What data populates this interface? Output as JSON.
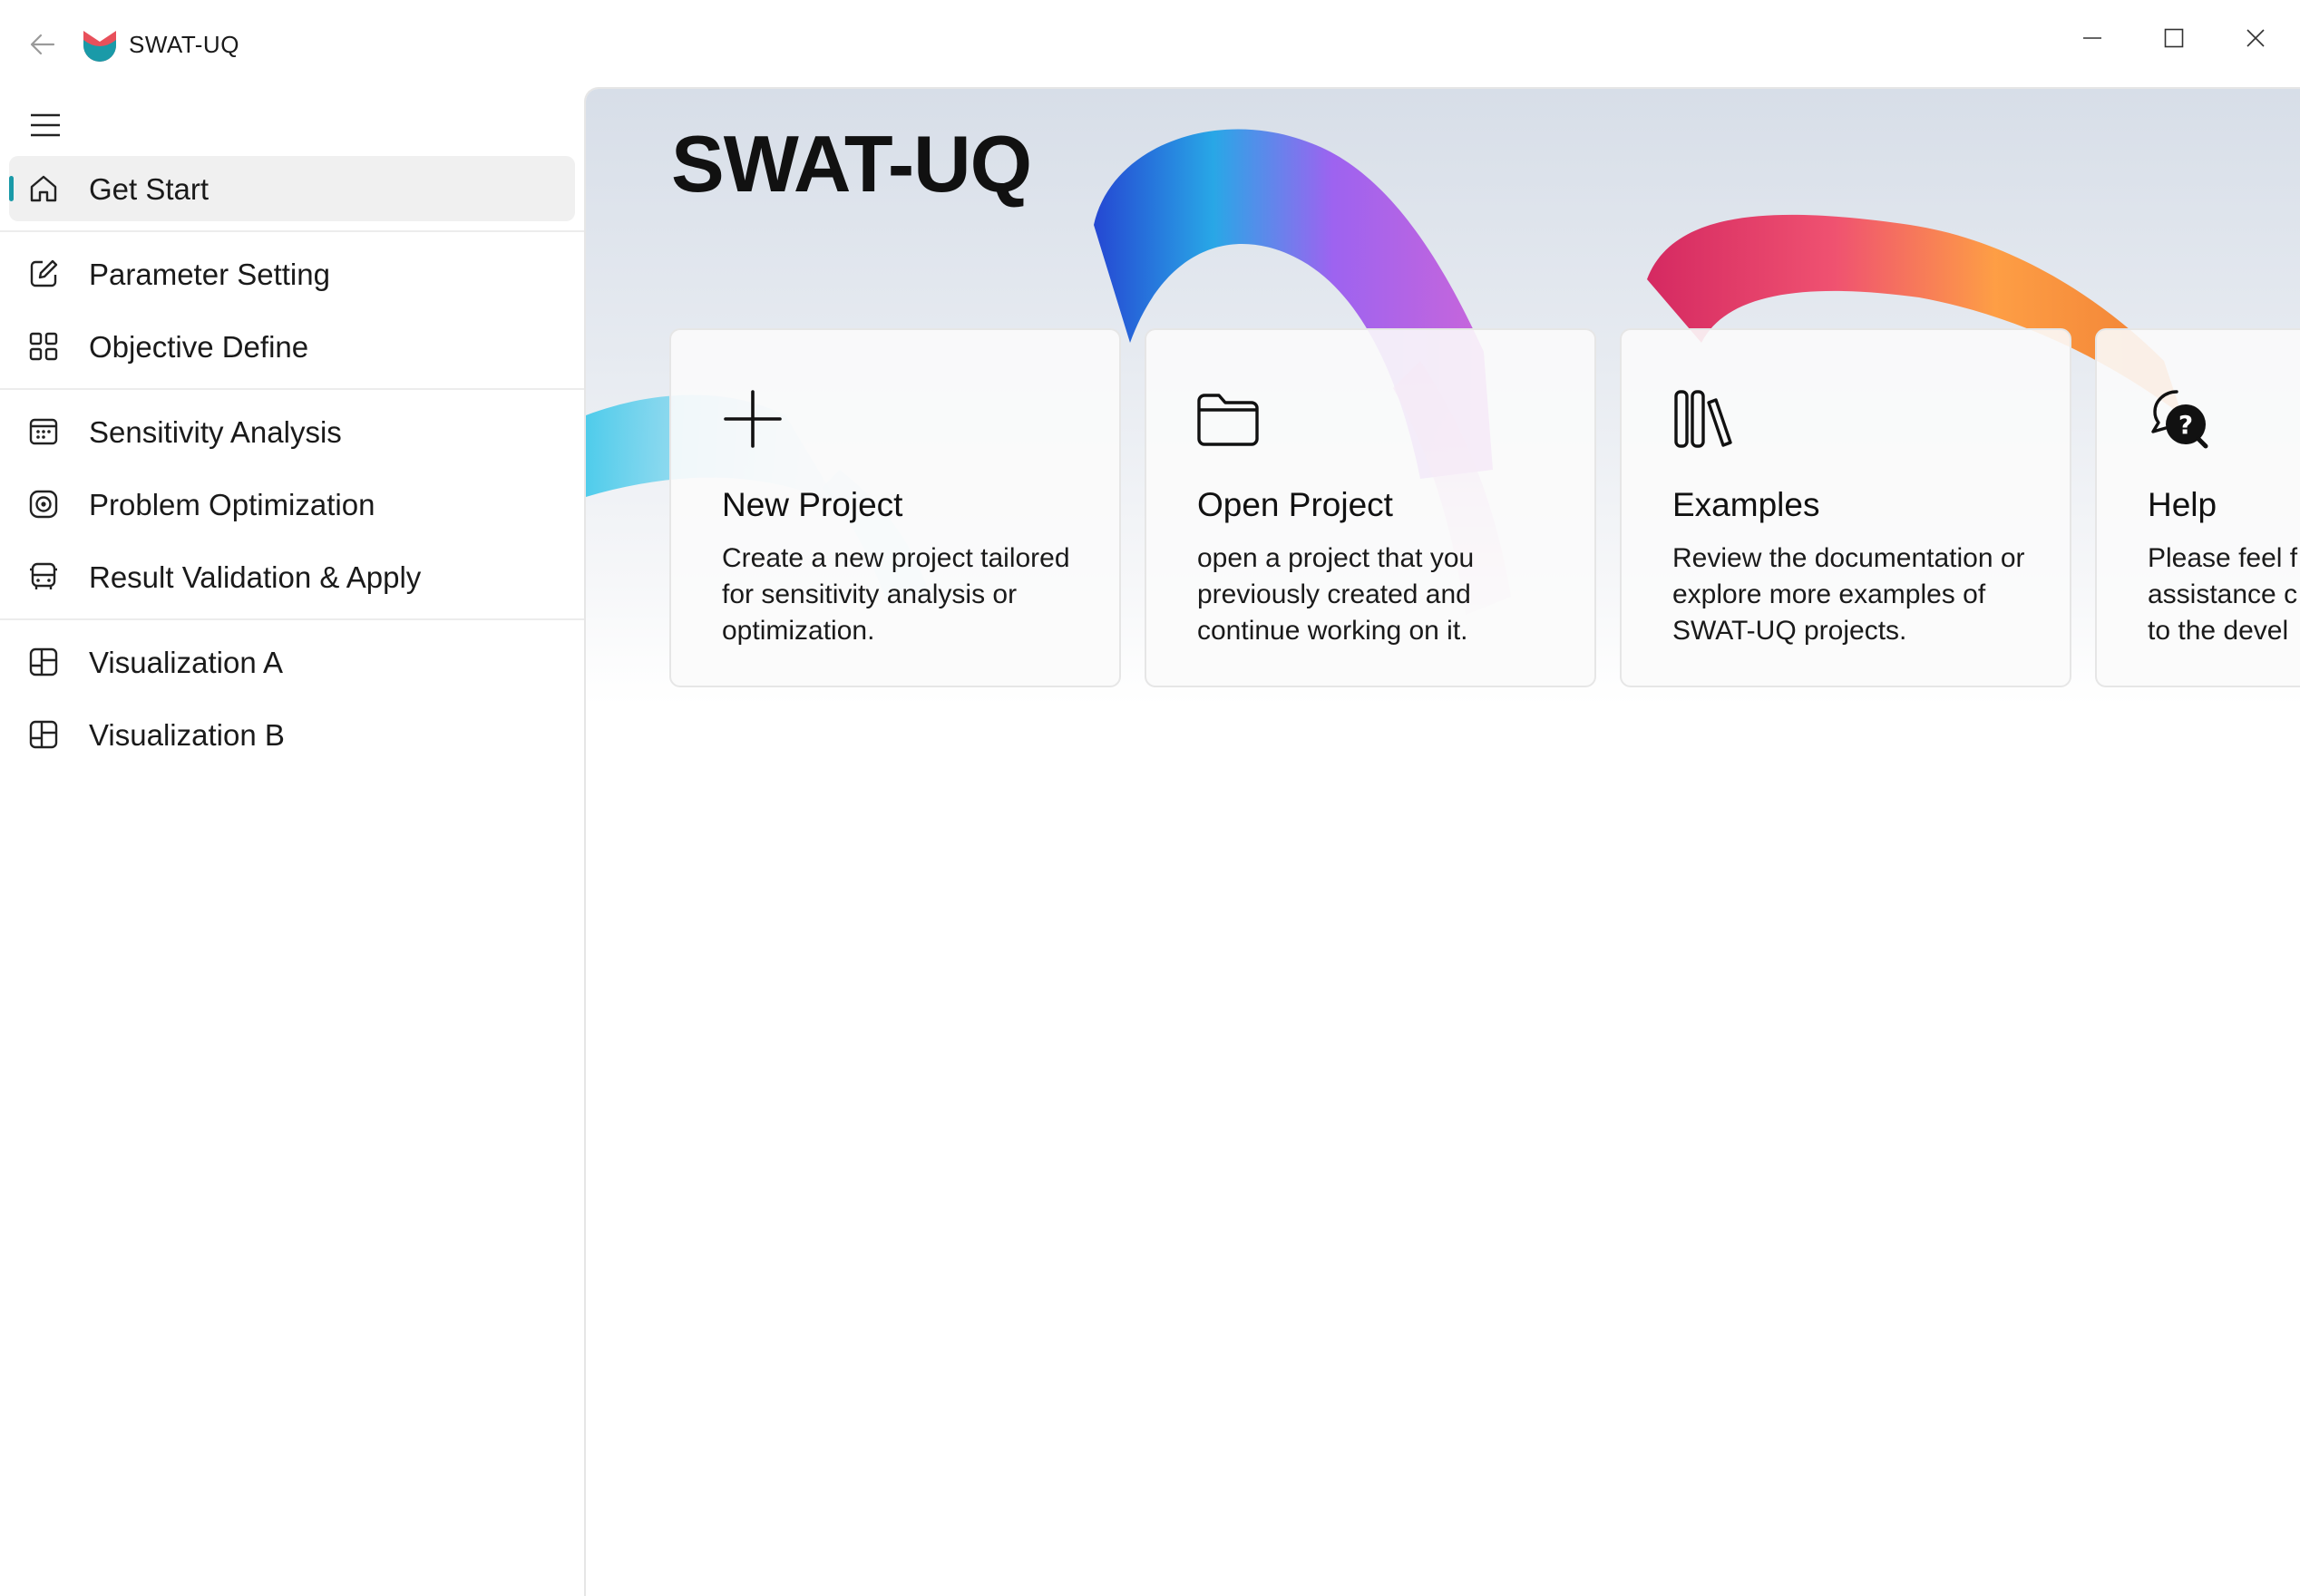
{
  "app": {
    "title": "SWAT-UQ",
    "accent_color": "#1a9aa8"
  },
  "titlebar": {
    "back_icon": "back-arrow-icon",
    "minimize_icon": "minimize-icon",
    "maximize_icon": "maximize-icon",
    "close_icon": "close-icon"
  },
  "sidebar": {
    "menu_icon": "hamburger-menu-icon",
    "items": [
      {
        "label": "Get Start",
        "icon": "home-icon",
        "active": true
      },
      {
        "label": "Parameter Setting",
        "icon": "edit-icon"
      },
      {
        "label": "Objective Define",
        "icon": "apps-grid-icon"
      },
      {
        "label": "Sensitivity Analysis",
        "icon": "calendar-icon"
      },
      {
        "label": "Problem Optimization",
        "icon": "target-icon"
      },
      {
        "label": "Result Validation & Apply",
        "icon": "vehicle-icon"
      },
      {
        "label": "Visualization A",
        "icon": "board-icon"
      },
      {
        "label": "Visualization B",
        "icon": "board-icon"
      }
    ]
  },
  "main": {
    "title": "SWAT-UQ",
    "cards": [
      {
        "title": "New Project",
        "icon": "add-icon",
        "desc_lines": [
          "Create a new project tailored",
          "for sensitivity analysis or",
          "optimization."
        ]
      },
      {
        "title": "Open Project",
        "icon": "folder-icon",
        "desc_lines": [
          "open a project that you",
          "previously created and",
          "continue working on it."
        ]
      },
      {
        "title": "Examples",
        "icon": "library-icon",
        "desc_lines": [
          "Review the documentation or",
          "explore more examples of",
          "SWAT-UQ projects."
        ]
      },
      {
        "title": "Help",
        "icon": "chat-help-icon",
        "desc_lines": [
          "Please feel f",
          "assistance c",
          "to the devel"
        ]
      }
    ]
  }
}
